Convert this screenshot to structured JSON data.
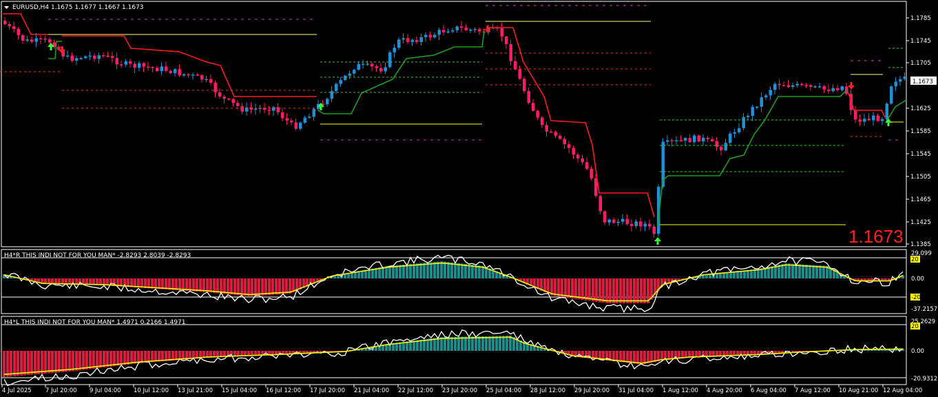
{
  "main": {
    "header": "EURUSD,H4  1.1675 1.1677 1.1667 1.1673",
    "current_price": "1.1673",
    "current_price_big": "1.1673",
    "price_labels": [
      "1.1785",
      "1.1745",
      "1.1705",
      "1.1625",
      "1.1585",
      "1.1545",
      "1.1505",
      "1.1465",
      "1.1425",
      "1.1385"
    ]
  },
  "sub1": {
    "header": "H4*R THIS INDI NOT FOR YOU MAN* -2.8293 2.8039 -2.8293",
    "labels": [
      "29.099",
      "20",
      "0.00",
      "-20",
      "-37.2157"
    ]
  },
  "sub2": {
    "header": "H4*L THIS INDI NOT FOR YOU MAN* 1.4971 0.2166 1.4971",
    "labels": [
      "25.2629",
      "20",
      "0.00",
      "-20.9312"
    ]
  },
  "time_labels": [
    "4 Jul 2025",
    "7 Jul 20:00",
    "9 Jul 04:00",
    "10 Jul 12:00",
    "13 Jul 21:00",
    "15 Jul 04:00",
    "16 Jul 12:00",
    "17 Jul 20:00",
    "21 Jul 04:00",
    "22 Jul 12:00",
    "23 Jul 20:00",
    "25 Jul 04:00",
    "28 Jul 12:00",
    "29 Jul 20:00",
    "31 Jul 04:00",
    "1 Aug 12:00",
    "4 Aug 20:00",
    "6 Aug 04:00",
    "7 Aug 12:00",
    "10 Aug 21:00",
    "12 Aug 04:00"
  ],
  "colors": {
    "background": "#000000",
    "bull_candle": "#1e90d8",
    "bear_candle": "#ff1a6a",
    "trail_down": "#ff1a1a",
    "trail_up": "#1aa01a",
    "hist_pos": "#1a8c8c",
    "hist_neg": "#d81c3c",
    "signal_yellow": "#ffff00",
    "line_white": "#ffffff",
    "big_price": "#ff2020"
  }
}
